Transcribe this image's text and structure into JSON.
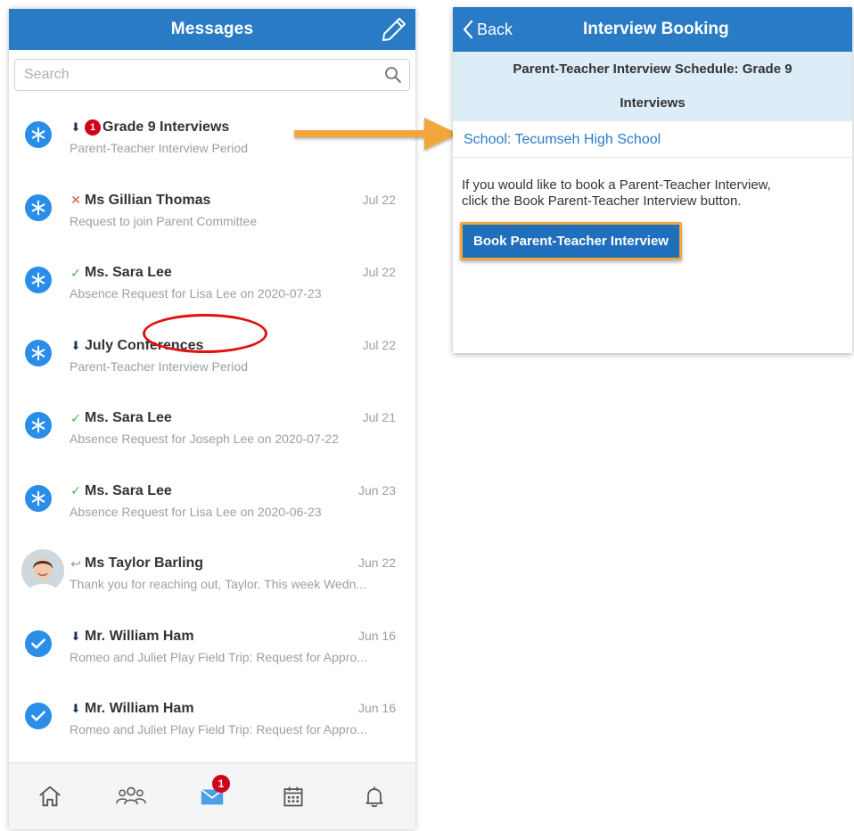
{
  "messages": {
    "title": "Messages",
    "search": {
      "placeholder": "Search"
    },
    "items": [
      {
        "status": "down",
        "badge": "1",
        "sender": "Grade 9 Interviews",
        "date": "",
        "preview": "Parent-Teacher Interview Period",
        "avatar": "asterisk"
      },
      {
        "status": "x",
        "sender": "Ms Gillian Thomas",
        "date": "Jul 22",
        "preview": "Request to join Parent Committee",
        "avatar": "asterisk"
      },
      {
        "status": "check",
        "sender": "Ms. Sara Lee",
        "date": "Jul 22",
        "preview": "Absence Request for Lisa Lee on 2020-07-23",
        "avatar": "asterisk"
      },
      {
        "status": "down",
        "sender": "July Conferences",
        "date": "Jul 22",
        "preview": "Parent-Teacher Interview Period",
        "avatar": "asterisk"
      },
      {
        "status": "check",
        "sender": "Ms. Sara Lee",
        "date": "Jul 21",
        "preview": "Absence Request for Joseph Lee on 2020-07-22",
        "avatar": "asterisk"
      },
      {
        "status": "check",
        "sender": "Ms. Sara Lee",
        "date": "Jun 23",
        "preview": "Absence Request for Lisa Lee on 2020-06-23",
        "avatar": "asterisk"
      },
      {
        "status": "reply",
        "sender": "Ms Taylor Barling",
        "date": "Jun 22",
        "preview": "Thank you for reaching out, Taylor. This week Wedn...",
        "avatar": "photo"
      },
      {
        "status": "down",
        "sender": "Mr. William Ham",
        "date": "Jun 16",
        "preview": "Romeo and Juliet Play Field Trip: Request for Appro...",
        "avatar": "check"
      },
      {
        "status": "down",
        "sender": "Mr. William Ham",
        "date": "Jun 16",
        "preview": "Romeo and Juliet Play Field Trip: Request for Appro...",
        "avatar": "check"
      }
    ],
    "tabbar": {
      "messages_badge": "1"
    }
  },
  "booking": {
    "back_label": "Back",
    "title": "Interview Booking",
    "schedule_line1": "Parent-Teacher Interview Schedule: Grade 9",
    "schedule_line2": "Interviews",
    "school_link": "School: Tecumseh High School",
    "instructions_line1": "If you would like to book a Parent-Teacher Interview,",
    "instructions_line2": "click the Book Parent-Teacher Interview button.",
    "book_button": "Book Parent-Teacher Interview"
  },
  "colors": {
    "header_blue": "#2a7bc6",
    "avatar_blue": "#2a8ee8",
    "badge_red": "#d0021b",
    "highlight_orange": "#f1a73a",
    "schedule_band": "#dcedf8",
    "annotation_red": "#e01010"
  }
}
